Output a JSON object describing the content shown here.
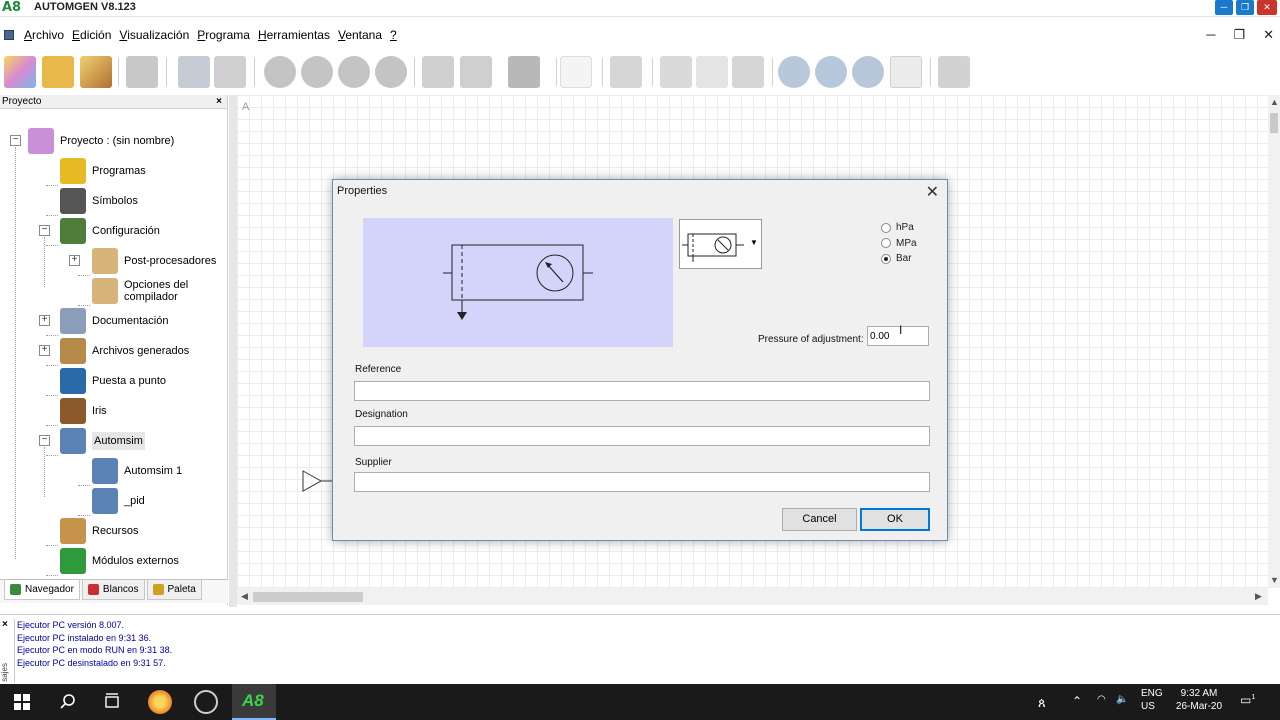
{
  "window": {
    "title": "AUTOMGEN V8.123",
    "logo_text": "A8"
  },
  "menu": [
    {
      "label": "Archivo",
      "key": "A",
      "rest": "rchivo"
    },
    {
      "label": "Edición",
      "key": "E",
      "rest": "dición"
    },
    {
      "label": "Visualización",
      "key": "V",
      "rest": "isualización"
    },
    {
      "label": "Programa",
      "key": "P",
      "rest": "rograma"
    },
    {
      "label": "Herramientas",
      "key": "H",
      "rest": "erramientas"
    },
    {
      "label": "Ventana",
      "key": "V",
      "rest": "entana"
    },
    {
      "label": "?",
      "key": "?",
      "rest": ""
    }
  ],
  "panel": {
    "title": "Proyecto",
    "close": "×",
    "tree": [
      {
        "id": "project",
        "label": "Proyecto : (sin nombre)",
        "icon": "project-icon",
        "color": "#c98fd8"
      },
      {
        "id": "programs",
        "label": "Programas",
        "icon": "programs-icon",
        "color": "#e7b923"
      },
      {
        "id": "symbols",
        "label": "Símbolos",
        "icon": "tag-icon",
        "color": "#555555"
      },
      {
        "id": "config",
        "label": "Configuración",
        "icon": "tools-icon",
        "color": "#4f7e3b"
      },
      {
        "id": "postproc",
        "label": "Post-procesadores",
        "icon": "folder-icon",
        "color": "#d7b47a"
      },
      {
        "id": "compiler",
        "label": "Opciones del compilador",
        "icon": "folder-icon",
        "color": "#d7b47a"
      },
      {
        "id": "docs",
        "label": "Documentación",
        "icon": "printer-icon",
        "color": "#8b9db8"
      },
      {
        "id": "generated",
        "label": "Archivos generados",
        "icon": "box-icon",
        "color": "#b58a4a"
      },
      {
        "id": "debug",
        "label": "Puesta a punto",
        "icon": "monitor-icon",
        "color": "#2a6aa8"
      },
      {
        "id": "iris",
        "label": "Iris",
        "icon": "gauge-icon",
        "color": "#8a5a2a"
      },
      {
        "id": "automsim",
        "label": "Automsim",
        "icon": "automsim-icon",
        "color": "#5a82b5"
      },
      {
        "id": "automsim1",
        "label": "Automsim 1",
        "icon": "automsim-icon",
        "color": "#5a82b5"
      },
      {
        "id": "pid",
        "label": "_pid",
        "icon": "automsim-error-icon",
        "color": "#5a82b5"
      },
      {
        "id": "resources",
        "label": "Recursos",
        "icon": "box-icon",
        "color": "#c6934d"
      },
      {
        "id": "modules",
        "label": "Módulos externos",
        "icon": "arrow-icon",
        "color": "#2f9a3b"
      }
    ],
    "tabs": [
      {
        "label": "Navegador",
        "icon": "navigator-icon",
        "color": "#3c8a3c"
      },
      {
        "label": "Blancos",
        "icon": "target-icon",
        "color": "#c83030"
      },
      {
        "label": "Paleta",
        "icon": "palette-icon",
        "color": "#d0a020"
      }
    ]
  },
  "canvas": {
    "letter": "A"
  },
  "log": {
    "side_label": "sajes",
    "close": "×",
    "lines": [
      "Ejecutor PC versión 8.007.",
      "Ejecutor PC instalado en 9:31 36.",
      "Ejecutor PC en modo RUN en 9:31 38.",
      "Ejecutor PC desinstalado en 9:31 57."
    ]
  },
  "dialog": {
    "title": "Properties",
    "close": "✕",
    "units": [
      {
        "label": "hPa",
        "checked": false
      },
      {
        "label": "MPa",
        "checked": false
      },
      {
        "label": "Bar",
        "checked": true
      }
    ],
    "pressure_label": "Pressure of adjustment:",
    "pressure_value": "0.00",
    "reference_label": "Reference",
    "reference_value": "",
    "designation_label": "Designation",
    "designation_value": "",
    "supplier_label": "Supplier",
    "supplier_value": "",
    "cancel": "Cancel",
    "ok": "OK"
  },
  "taskbar": {
    "lang1": "ENG",
    "lang2": "US",
    "time": "9:32 AM",
    "date": "26-Mar-20",
    "notif_count": "1"
  }
}
